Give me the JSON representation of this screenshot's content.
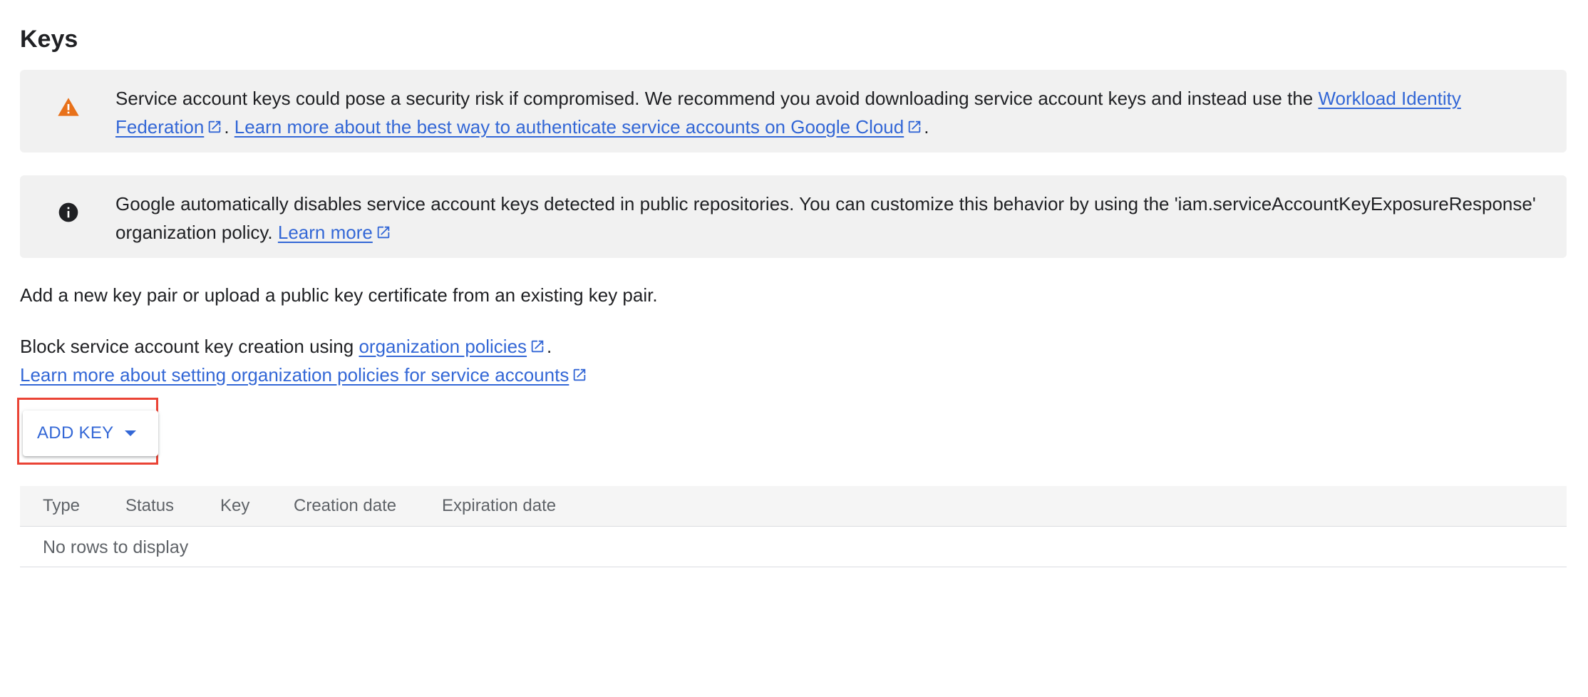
{
  "section": {
    "title": "Keys"
  },
  "warning_banner": {
    "icon": "warning-icon",
    "icon_color": "#e8711a",
    "text_before": "Service account keys could pose a security risk if compromised. We recommend you avoid downloading service account keys and instead use the ",
    "link1_label": "Workload Identity Federation",
    "separator": ". ",
    "link2_label": "Learn more about the best way to authenticate service accounts on Google Cloud",
    "text_after": "."
  },
  "info_banner": {
    "icon": "info-icon",
    "text_before": "Google automatically disables service account keys detected in public repositories. You can customize this behavior by using the 'iam.serviceAccountKeyExposureResponse' organization policy. ",
    "link_label": "Learn more"
  },
  "description": {
    "add_key_text": "Add a new key pair or upload a public key certificate from an existing key pair.",
    "block_text": "Block service account key creation using ",
    "org_policies_link": "organization policies",
    "block_text_after": ".",
    "learn_more_link": "Learn more about setting organization policies for service accounts"
  },
  "add_key_button": {
    "label": "ADD KEY",
    "accent_color": "#3367d6",
    "highlight_color": "#ea4335"
  },
  "keys_table": {
    "columns": [
      "Type",
      "Status",
      "Key",
      "Creation date",
      "Expiration date"
    ],
    "empty_message": "No rows to display"
  },
  "colors": {
    "link": "#3367d6",
    "banner_bg": "#f1f1f1",
    "text": "#202124",
    "muted": "#5f6368"
  }
}
